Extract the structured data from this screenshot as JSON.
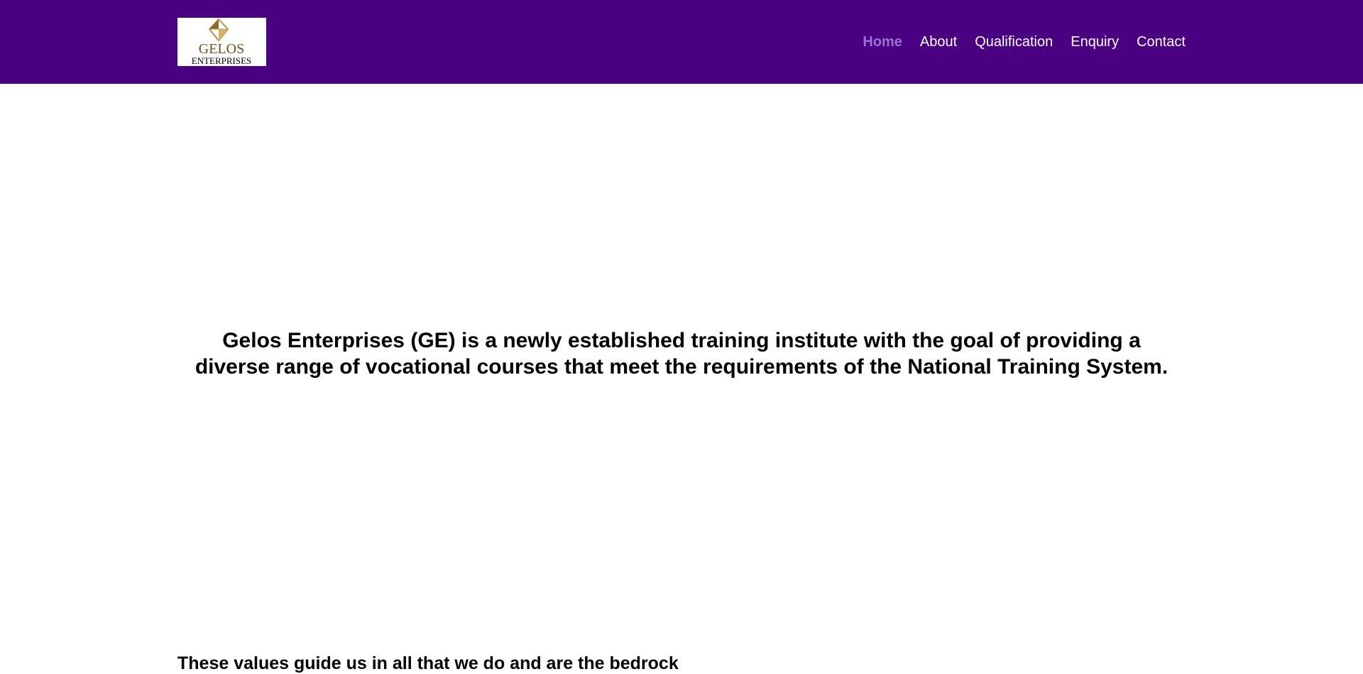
{
  "header": {
    "logo": {
      "line1": "GELOS",
      "line2": "ENTERPRISES",
      "icon": "diamond-icon"
    },
    "nav": [
      {
        "label": "Home",
        "active": true
      },
      {
        "label": "About",
        "active": false
      },
      {
        "label": "Qualification",
        "active": false
      },
      {
        "label": "Enquiry",
        "active": false
      },
      {
        "label": "Contact",
        "active": false
      }
    ]
  },
  "hero": {
    "text": "Gelos Enterprises (GE) is a newly established training institute with the goal of providing a diverse range of vocational courses that meet the requirements of the National Training System."
  },
  "values": {
    "text": "These values guide us in all that we do and are the bedrock"
  },
  "colors": {
    "header_bg": "#4b0082",
    "nav_text": "#ffffff",
    "nav_active": "#9b72d6",
    "logo_gold": "#b8924a"
  }
}
